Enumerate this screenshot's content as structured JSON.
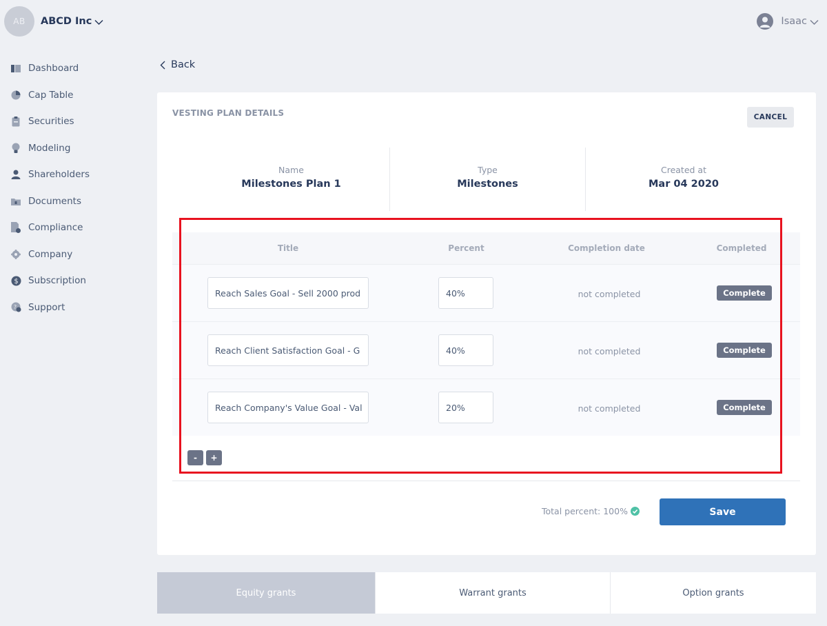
{
  "company": {
    "initials": "AB",
    "name": "ABCD Inc"
  },
  "user": {
    "name": "Isaac"
  },
  "sidebar": {
    "items": [
      {
        "label": "Dashboard",
        "icon": "dashboard-icon"
      },
      {
        "label": "Cap Table",
        "icon": "pie-chart-icon"
      },
      {
        "label": "Securities",
        "icon": "clipboard-icon"
      },
      {
        "label": "Modeling",
        "icon": "lightbulb-icon"
      },
      {
        "label": "Shareholders",
        "icon": "person-icon"
      },
      {
        "label": "Documents",
        "icon": "folder-icon"
      },
      {
        "label": "Compliance",
        "icon": "document-check-icon"
      },
      {
        "label": "Company",
        "icon": "cog-icon"
      },
      {
        "label": "Subscription",
        "icon": "dollar-icon"
      },
      {
        "label": "Support",
        "icon": "help-icon"
      }
    ]
  },
  "back_label": "Back",
  "card": {
    "title": "VESTING PLAN DETAILS",
    "cancel_label": "CANCEL",
    "info": {
      "name_label": "Name",
      "name_value": "Milestones Plan 1",
      "type_label": "Type",
      "type_value": "Milestones",
      "created_label": "Created at",
      "created_value": "Mar 04 2020"
    },
    "table": {
      "headers": {
        "title": "Title",
        "percent": "Percent",
        "completion_date": "Completion date",
        "completed": "Completed"
      },
      "rows": [
        {
          "title": "Reach Sales Goal - Sell 2000 prod",
          "percent": "40%",
          "completion_date": "not completed",
          "action": "Complete"
        },
        {
          "title": "Reach Client Satisfaction Goal - G",
          "percent": "40%",
          "completion_date": "not completed",
          "action": "Complete"
        },
        {
          "title": "Reach Company's Value Goal - Val",
          "percent": "20%",
          "completion_date": "not completed",
          "action": "Complete"
        }
      ],
      "remove_label": "-",
      "add_label": "+"
    },
    "total_text": "Total percent: 100%",
    "save_label": "Save"
  },
  "tabs": [
    {
      "label": "Equity grants",
      "active": true
    },
    {
      "label": "Warrant grants",
      "active": false
    },
    {
      "label": "Option grants",
      "active": false
    }
  ],
  "colors": {
    "accent": "#2f72b8",
    "highlight": "#e8121f",
    "success": "#4fc1a6"
  }
}
